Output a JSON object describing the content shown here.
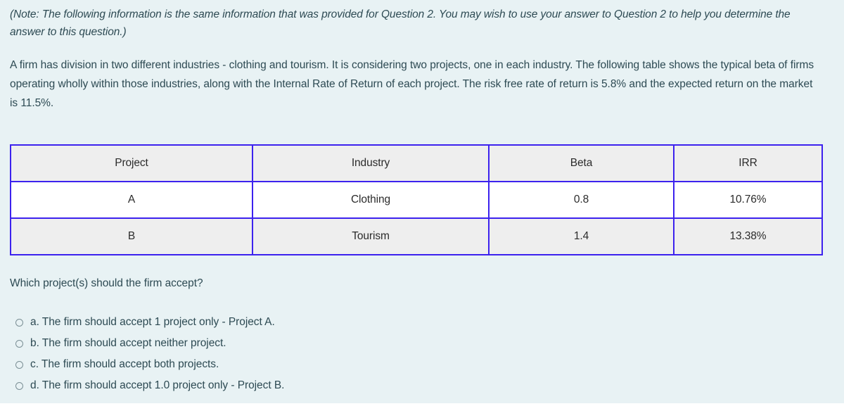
{
  "page": {
    "background_color": "#e8f2f4",
    "text_color": "#2d4a53",
    "table_border_color": "#3c22ee"
  },
  "note": "(Note: The following information is the same information that was provided for Question 2.  You may wish to use your answer to Question 2 to help you determine the answer to this question.)",
  "intro": " A firm has division in two different industries - clothing and tourism.  It is considering two projects, one in each industry.  The following table shows the typical beta of firms operating wholly within those industries, along with the Internal Rate of Return of each project.  The risk free rate of return is 5.8% and the expected return on the market is 11.5%.",
  "table": {
    "headers": [
      "Project",
      "Industry",
      "Beta",
      "IRR"
    ],
    "rows": [
      [
        "A",
        "Clothing",
        "0.8",
        "10.76%"
      ],
      [
        "B",
        "Tourism",
        "1.4",
        "13.38%"
      ]
    ]
  },
  "question": "Which project(s) should the firm accept?",
  "options": [
    {
      "id": "a",
      "label": "a. The firm should accept 1 project only - Project A.",
      "selected": false
    },
    {
      "id": "b",
      "label": "b. The firm should accept neither project.",
      "selected": false
    },
    {
      "id": "c",
      "label": "c. The firm should accept both projects.",
      "selected": false
    },
    {
      "id": "d",
      "label": "d. The firm should accept 1.0 project only - Project B.",
      "selected": false
    }
  ]
}
